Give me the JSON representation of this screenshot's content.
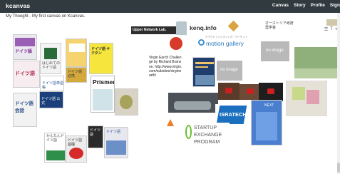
{
  "app": {
    "logo": "kcanvas"
  },
  "nav": [
    "Canvas",
    "Story",
    "Profile",
    "Sign"
  ],
  "subtitle": "My Thought - My first canvas on Kcanvas.",
  "tiles": {
    "upper_banner": "Upper Network Lab.",
    "kengo": "kenq.info",
    "motion_gallery_sub": "クラウドファンディング・マーケット",
    "motion_gallery": "motion gallery",
    "austria": "オーストリア政府奨学金",
    "no_image": "no image",
    "virgin_note": "Virgin Earch Challenge by Richard Branson. http://www.virgin.com/subsites/virginearth/",
    "isratech": "ISRATECH",
    "startup_line1": "STARTUP",
    "startup_line2": "EXCHANGE",
    "startup_line3": "PROGRAM",
    "prismen": "Prismen",
    "book_doitsugo": "ドイツ語",
    "book_doitsugo2": "ドイツ語",
    "book_vocab": "ドイツ語単語帳",
    "book_kaiwa": "ドイツ語会話",
    "book_koshiki": "ドイツ語 公式",
    "book_kantan": "かんたんドイツ語",
    "book_hikkei": "ドイツ語 必携",
    "book_shinkyo": "ドイツ語",
    "book_start": "はじめてのドイツ語",
    "book_kiso": "ドイツ語 基礎",
    "book_yellow": "ドイツ語 キクタン",
    "book_next": "NEXT",
    "book_green": "ドイツ語"
  },
  "toolbar": [
    "☰",
    "T",
    "✎"
  ]
}
